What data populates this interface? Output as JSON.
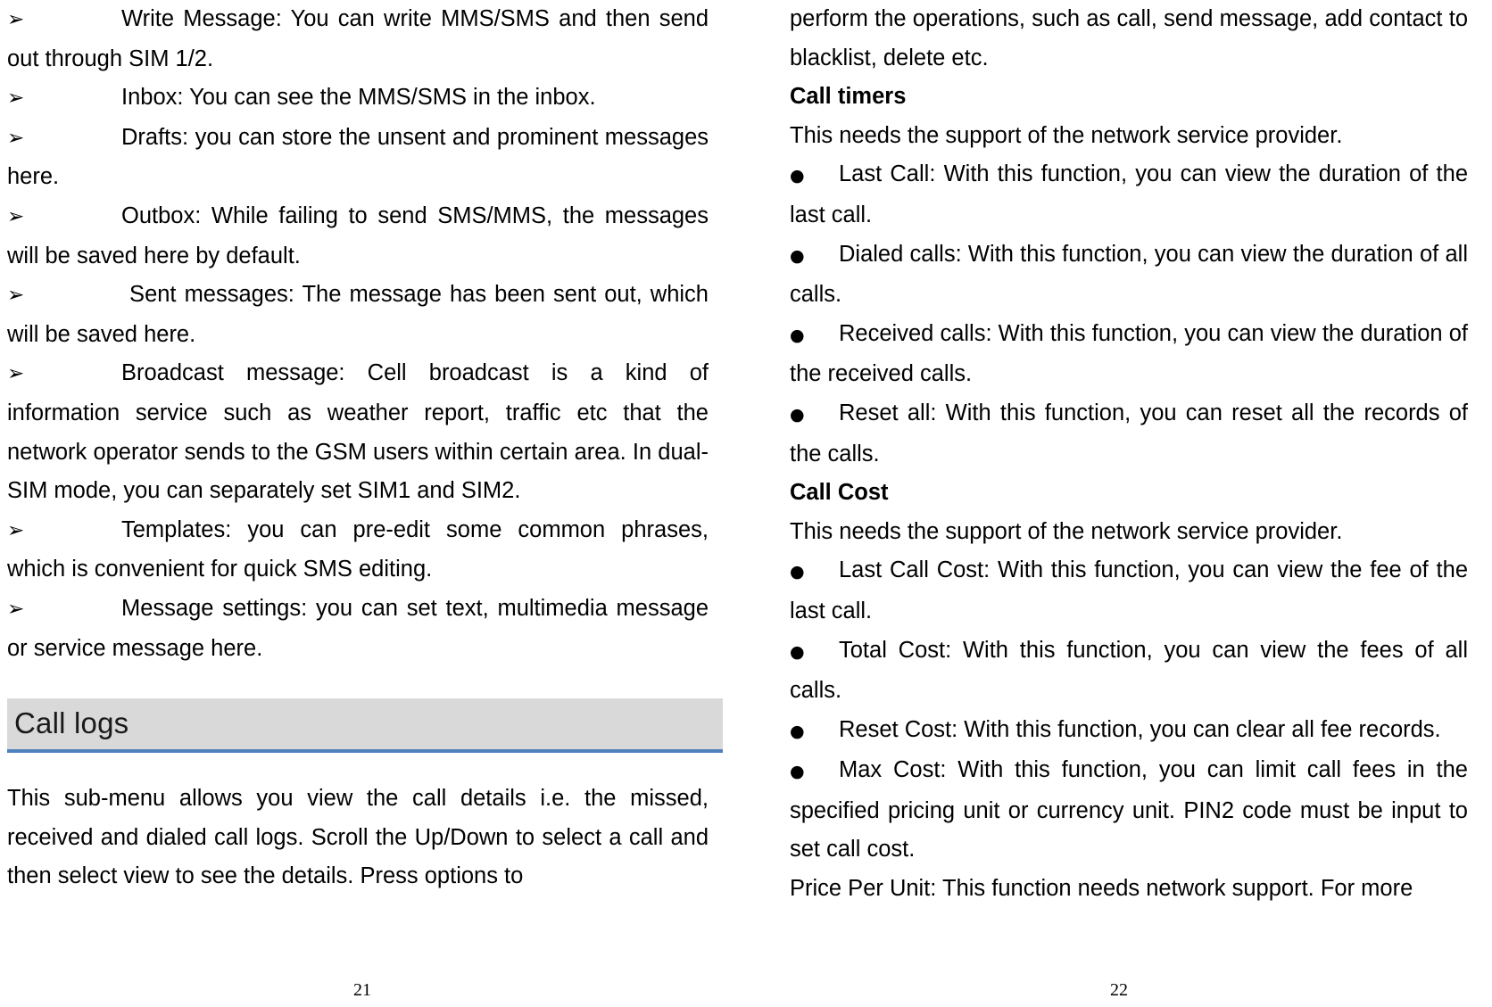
{
  "document": {
    "type": "mobile-phone-user-manual-spread",
    "colors": {
      "heading_band": "#D9D9D9",
      "heading_rule": "#4F81BD",
      "text": "#000000"
    },
    "glyphs": {
      "arrow_bullet": "➢",
      "round_bullet": "●"
    }
  },
  "left_page": {
    "folio": "21",
    "blocks": [
      {
        "kind": "arrow-item",
        "text": "Write Message: You can write MMS/SMS and then send out through SIM 1/2."
      },
      {
        "kind": "arrow-item",
        "text": "Inbox: You can see the MMS/SMS in the inbox."
      },
      {
        "kind": "arrow-item",
        "text": "Drafts: you can store the unsent and prominent messages here."
      },
      {
        "kind": "arrow-item",
        "text": "Outbox: While failing to send SMS/MMS, the messages will be saved here by default."
      },
      {
        "kind": "arrow-item",
        "text": " Sent messages: The message has been sent out, which will be saved here."
      },
      {
        "kind": "arrow-item",
        "text": "Broadcast message: Cell broadcast is a kind of information service such as weather report, traffic etc that the network operator sends to the GSM users within certain area. In dual-SIM mode, you can separately set SIM1 and SIM2."
      },
      {
        "kind": "arrow-item",
        "text": "Templates: you can pre-edit some common phrases, which is convenient for quick SMS editing."
      },
      {
        "kind": "arrow-item",
        "text": "Message settings: you can set text, multimedia message or service message here."
      },
      {
        "kind": "section-heading",
        "text": "Call logs"
      },
      {
        "kind": "body",
        "text": "This sub-menu allows you view the call details i.e. the missed, received and dialed call logs. Scroll the Up/Down to select a call and then select view to see the details. Press options to"
      }
    ]
  },
  "right_page": {
    "folio": "22",
    "blocks": [
      {
        "kind": "body",
        "text": "perform the operations, such as call, send message, add contact to blacklist, delete etc."
      },
      {
        "kind": "subhead",
        "text": "Call timers"
      },
      {
        "kind": "body",
        "text": "This needs the support of the network service provider."
      },
      {
        "kind": "dot-item",
        "text": "Last Call: With this function, you can view the duration of the last call."
      },
      {
        "kind": "dot-item",
        "text": "Dialed calls: With this function, you can view the duration of all calls."
      },
      {
        "kind": "dot-item",
        "text": "Received calls: With this function, you can view the duration of the received calls."
      },
      {
        "kind": "dot-item",
        "text": "Reset all: With this function, you can reset all the records of the calls."
      },
      {
        "kind": "subhead",
        "text": "Call Cost"
      },
      {
        "kind": "body",
        "text": "This needs the support of the network service provider."
      },
      {
        "kind": "dot-item",
        "text": "Last Call Cost: With this function, you can view the fee of the last call."
      },
      {
        "kind": "dot-item",
        "text": "Total Cost: With this function, you can view the fees of all calls."
      },
      {
        "kind": "dot-item",
        "text": "Reset Cost: With this function, you can clear all fee records."
      },
      {
        "kind": "dot-item",
        "text": "Max Cost: With this function, you can limit call fees in the specified pricing unit or currency unit. PIN2 code must be input to set call cost."
      },
      {
        "kind": "body",
        "text": "Price Per Unit: This function needs network support. For more"
      }
    ]
  }
}
